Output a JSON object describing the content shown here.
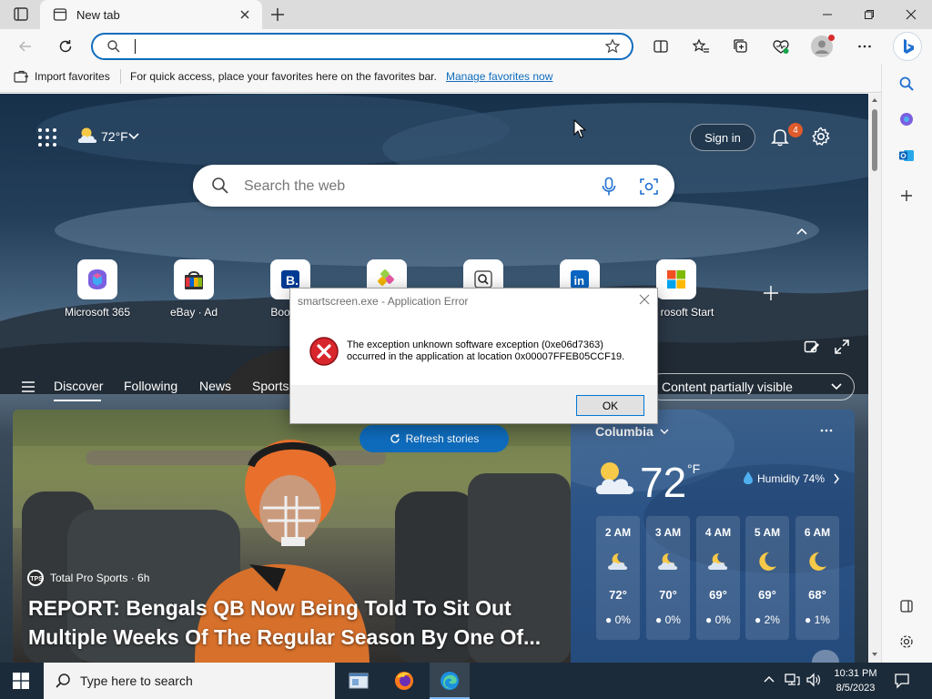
{
  "browser": {
    "tab_title": "New tab",
    "address_value": "",
    "favorites_bar": {
      "import_label": "Import favorites",
      "hint": "For quick access, place your favorites here on the favorites bar.",
      "manage_link": "Manage favorites now"
    }
  },
  "newtab": {
    "weather_chip": "72°F",
    "sign_in": "Sign in",
    "notification_count": "4",
    "search_placeholder": "Search the web",
    "quick_links": [
      {
        "label": "Microsoft 365",
        "icon": "microsoft365-icon"
      },
      {
        "label": "eBay · Ad",
        "icon": "ebay-icon"
      },
      {
        "label": "Booking",
        "icon": "booking-icon"
      },
      {
        "label": "",
        "icon": "app-icon"
      },
      {
        "label": "",
        "icon": "search-app-icon"
      },
      {
        "label": "",
        "icon": "linkedin-icon"
      },
      {
        "label": "rosoft Start",
        "icon": "microsoft-start-icon"
      }
    ],
    "feed_nav": [
      "Discover",
      "Following",
      "News",
      "Sports"
    ],
    "content_visibility": "Content partially visible",
    "refresh_label": "Refresh stories",
    "hero": {
      "source": "Total Pro Sports · 6h",
      "title": "REPORT: Bengals QB Now Being Told To Sit Out Multiple Weeks Of The Regular Season By One Of..."
    },
    "weather": {
      "city": "Columbia",
      "temp": "72",
      "unit": "°F",
      "humidity": "Humidity 74%",
      "hourly": [
        {
          "time": "2 AM",
          "temp": "72°",
          "precip": "0%",
          "icon": "partly-cloudy-night-icon"
        },
        {
          "time": "3 AM",
          "temp": "70°",
          "precip": "0%",
          "icon": "partly-cloudy-night-icon"
        },
        {
          "time": "4 AM",
          "temp": "69°",
          "precip": "0%",
          "icon": "partly-cloudy-night-icon"
        },
        {
          "time": "5 AM",
          "temp": "69°",
          "precip": "2%",
          "icon": "moon-icon"
        },
        {
          "time": "6 AM",
          "temp": "68°",
          "precip": "1%",
          "icon": "moon-icon"
        }
      ]
    }
  },
  "dialog": {
    "title": "smartscreen.exe - Application Error",
    "line1": "The exception unknown software exception (0xe06d7363)",
    "line2": "occurred in the application at location 0x00007FFEB05CCF19.",
    "ok": "OK"
  },
  "taskbar": {
    "search_placeholder": "Type here to search",
    "time": "10:31 PM",
    "date": "8/5/2023"
  },
  "colors": {
    "accent": "#0f6cbd",
    "error_red": "#d8262d",
    "taskbar": "#1c2b3a"
  }
}
